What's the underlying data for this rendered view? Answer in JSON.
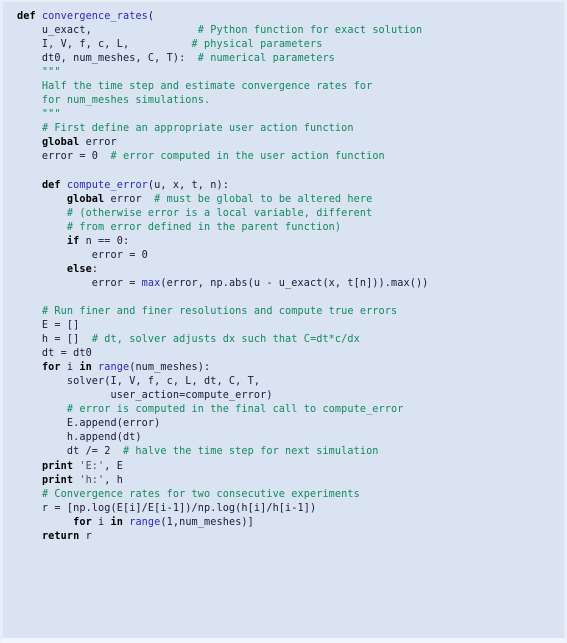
{
  "listing": {
    "language": "Python",
    "background_color": "#dae3f1",
    "border_color": "#e8eef8",
    "colors": {
      "keyword": "#000000",
      "function_name": "#2b2bb0",
      "comment": "#138a5e",
      "string": "#4c4c4c",
      "identifier": "#1a1a3a"
    },
    "lines": [
      [
        {
          "t": "def ",
          "c": "k"
        },
        {
          "t": "convergence_rates",
          "c": "nf"
        },
        {
          "t": "(",
          "c": "p"
        }
      ],
      [
        {
          "t": "    u_exact,",
          "c": "n"
        },
        {
          "t": "                 ",
          "c": "n"
        },
        {
          "t": "# Python function for exact solution",
          "c": "c"
        }
      ],
      [
        {
          "t": "    I, V, f, c, L,",
          "c": "n"
        },
        {
          "t": "          ",
          "c": "n"
        },
        {
          "t": "# physical parameters",
          "c": "c"
        }
      ],
      [
        {
          "t": "    dt0, num_meshes, C, T):",
          "c": "n"
        },
        {
          "t": "  ",
          "c": "n"
        },
        {
          "t": "# numerical parameters",
          "c": "c"
        }
      ],
      [
        {
          "t": "    \"\"\"",
          "c": "sd"
        }
      ],
      [
        {
          "t": "    Half the time step and estimate convergence rates for",
          "c": "sd"
        }
      ],
      [
        {
          "t": "    for num_meshes simulations.",
          "c": "sd"
        }
      ],
      [
        {
          "t": "    \"\"\"",
          "c": "sd"
        }
      ],
      [
        {
          "t": "    ",
          "c": "n"
        },
        {
          "t": "# First define an appropriate user action function",
          "c": "c"
        }
      ],
      [
        {
          "t": "    ",
          "c": "n"
        },
        {
          "t": "global",
          "c": "k"
        },
        {
          "t": " error",
          "c": "n"
        }
      ],
      [
        {
          "t": "    error = 0  ",
          "c": "n"
        },
        {
          "t": "# error computed in the user action function",
          "c": "c"
        }
      ],
      [
        {
          "t": "",
          "c": "n"
        }
      ],
      [
        {
          "t": "    ",
          "c": "n"
        },
        {
          "t": "def ",
          "c": "k"
        },
        {
          "t": "compute_error",
          "c": "nf"
        },
        {
          "t": "(u, x, t, n):",
          "c": "p"
        }
      ],
      [
        {
          "t": "        ",
          "c": "n"
        },
        {
          "t": "global",
          "c": "k"
        },
        {
          "t": " error  ",
          "c": "n"
        },
        {
          "t": "# must be global to be altered here",
          "c": "c"
        }
      ],
      [
        {
          "t": "        ",
          "c": "n"
        },
        {
          "t": "# (otherwise error is a local variable, different",
          "c": "c"
        }
      ],
      [
        {
          "t": "        ",
          "c": "n"
        },
        {
          "t": "# from error defined in the parent function)",
          "c": "c"
        }
      ],
      [
        {
          "t": "        ",
          "c": "n"
        },
        {
          "t": "if",
          "c": "k"
        },
        {
          "t": " n == 0:",
          "c": "n"
        }
      ],
      [
        {
          "t": "            error = 0",
          "c": "n"
        }
      ],
      [
        {
          "t": "        ",
          "c": "n"
        },
        {
          "t": "else",
          "c": "k"
        },
        {
          "t": ":",
          "c": "n"
        }
      ],
      [
        {
          "t": "            error = ",
          "c": "n"
        },
        {
          "t": "max",
          "c": "nb"
        },
        {
          "t": "(error, np.abs(u - u_exact(x, t[n])).max())",
          "c": "n"
        }
      ],
      [
        {
          "t": "",
          "c": "n"
        }
      ],
      [
        {
          "t": "    ",
          "c": "n"
        },
        {
          "t": "# Run finer and finer resolutions and compute true errors",
          "c": "c"
        }
      ],
      [
        {
          "t": "    E = []",
          "c": "n"
        }
      ],
      [
        {
          "t": "    h = []  ",
          "c": "n"
        },
        {
          "t": "# dt, solver adjusts dx such that C=dt*c/dx",
          "c": "c"
        }
      ],
      [
        {
          "t": "    dt = dt0",
          "c": "n"
        }
      ],
      [
        {
          "t": "    ",
          "c": "n"
        },
        {
          "t": "for",
          "c": "k"
        },
        {
          "t": " i ",
          "c": "n"
        },
        {
          "t": "in",
          "c": "k"
        },
        {
          "t": " ",
          "c": "n"
        },
        {
          "t": "range",
          "c": "nb"
        },
        {
          "t": "(num_meshes):",
          "c": "n"
        }
      ],
      [
        {
          "t": "        solver(I, V, f, c, L, dt, C, T,",
          "c": "n"
        }
      ],
      [
        {
          "t": "               user_action=compute_error)",
          "c": "n"
        }
      ],
      [
        {
          "t": "        ",
          "c": "n"
        },
        {
          "t": "# error is computed in the final call to compute_error",
          "c": "c"
        }
      ],
      [
        {
          "t": "        E.append(error)",
          "c": "n"
        }
      ],
      [
        {
          "t": "        h.append(dt)",
          "c": "n"
        }
      ],
      [
        {
          "t": "        dt /= 2  ",
          "c": "n"
        },
        {
          "t": "# halve the time step for next simulation",
          "c": "c"
        }
      ],
      [
        {
          "t": "    ",
          "c": "n"
        },
        {
          "t": "print",
          "c": "k"
        },
        {
          "t": " ",
          "c": "n"
        },
        {
          "t": "'E:'",
          "c": "s"
        },
        {
          "t": ", E",
          "c": "n"
        }
      ],
      [
        {
          "t": "    ",
          "c": "n"
        },
        {
          "t": "print",
          "c": "k"
        },
        {
          "t": " ",
          "c": "n"
        },
        {
          "t": "'h:'",
          "c": "s"
        },
        {
          "t": ", h",
          "c": "n"
        }
      ],
      [
        {
          "t": "    ",
          "c": "n"
        },
        {
          "t": "# Convergence rates for two consecutive experiments",
          "c": "c"
        }
      ],
      [
        {
          "t": "    r = [np.log(E[i]/E[i-1])/np.log(h[i]/h[i-1])",
          "c": "n"
        }
      ],
      [
        {
          "t": "         ",
          "c": "n"
        },
        {
          "t": "for",
          "c": "k"
        },
        {
          "t": " i ",
          "c": "n"
        },
        {
          "t": "in",
          "c": "k"
        },
        {
          "t": " ",
          "c": "n"
        },
        {
          "t": "range",
          "c": "nb"
        },
        {
          "t": "(1,num_meshes)]",
          "c": "n"
        }
      ],
      [
        {
          "t": "    ",
          "c": "n"
        },
        {
          "t": "return",
          "c": "k"
        },
        {
          "t": " r",
          "c": "n"
        }
      ]
    ]
  }
}
